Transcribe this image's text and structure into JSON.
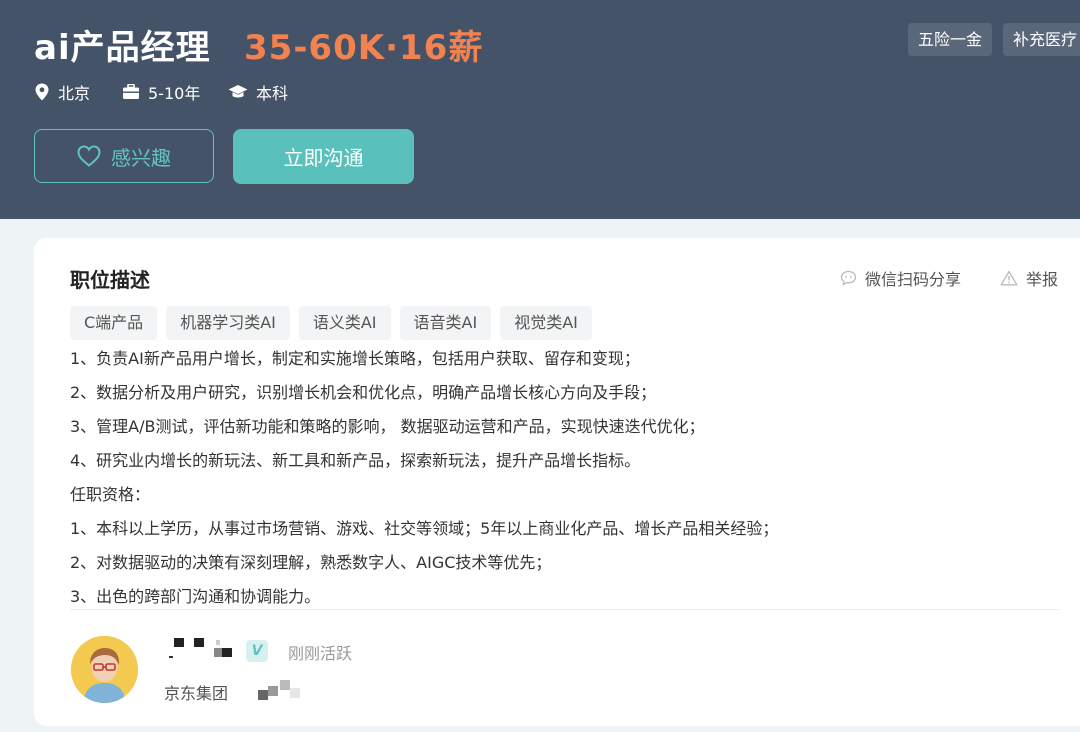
{
  "job": {
    "title": "ai产品经理",
    "salary": "35-60K·16薪",
    "welfare": [
      "五险一金",
      "补充医疗"
    ],
    "city": "北京",
    "experience": "5-10年",
    "degree": "本科"
  },
  "actions": {
    "interest_label": "感兴趣",
    "chat_label": "立即沟通"
  },
  "description": {
    "section_title": "职位描述",
    "share_label": "微信扫码分享",
    "report_label": "举报",
    "tags": [
      "C端产品",
      "机器学习类AI",
      "语义类AI",
      "语音类AI",
      "视觉类AI"
    ],
    "lines": [
      "1、负责AI新产品用户增长，制定和实施增长策略，包括用户获取、留存和变现；",
      "2、数据分析及用户研究，识别增长机会和优化点，明确产品增长核心方向及手段；",
      "3、管理A/B测试，评估新功能和策略的影响， 数据驱动运营和产品，实现快速迭代优化；",
      "4、研究业内增长的新玩法、新工具和新产品，探索新玩法，提升产品增长指标。",
      "任职资格：",
      "1、本科以上学历，从事过市场营销、游戏、社交等领域；5年以上商业化产品、增长产品相关经验；",
      "2、对数据驱动的决策有深刻理解，熟悉数字人、AIGC技术等优先；",
      "3、出色的跨部门沟通和协调能力。"
    ]
  },
  "recruiter": {
    "verified_badge": "V",
    "active_status": "刚刚活跃",
    "company": "京东集团"
  },
  "colors": {
    "header_bg": "#445368",
    "salary": "#f2824f",
    "accent": "#59c0bc"
  }
}
